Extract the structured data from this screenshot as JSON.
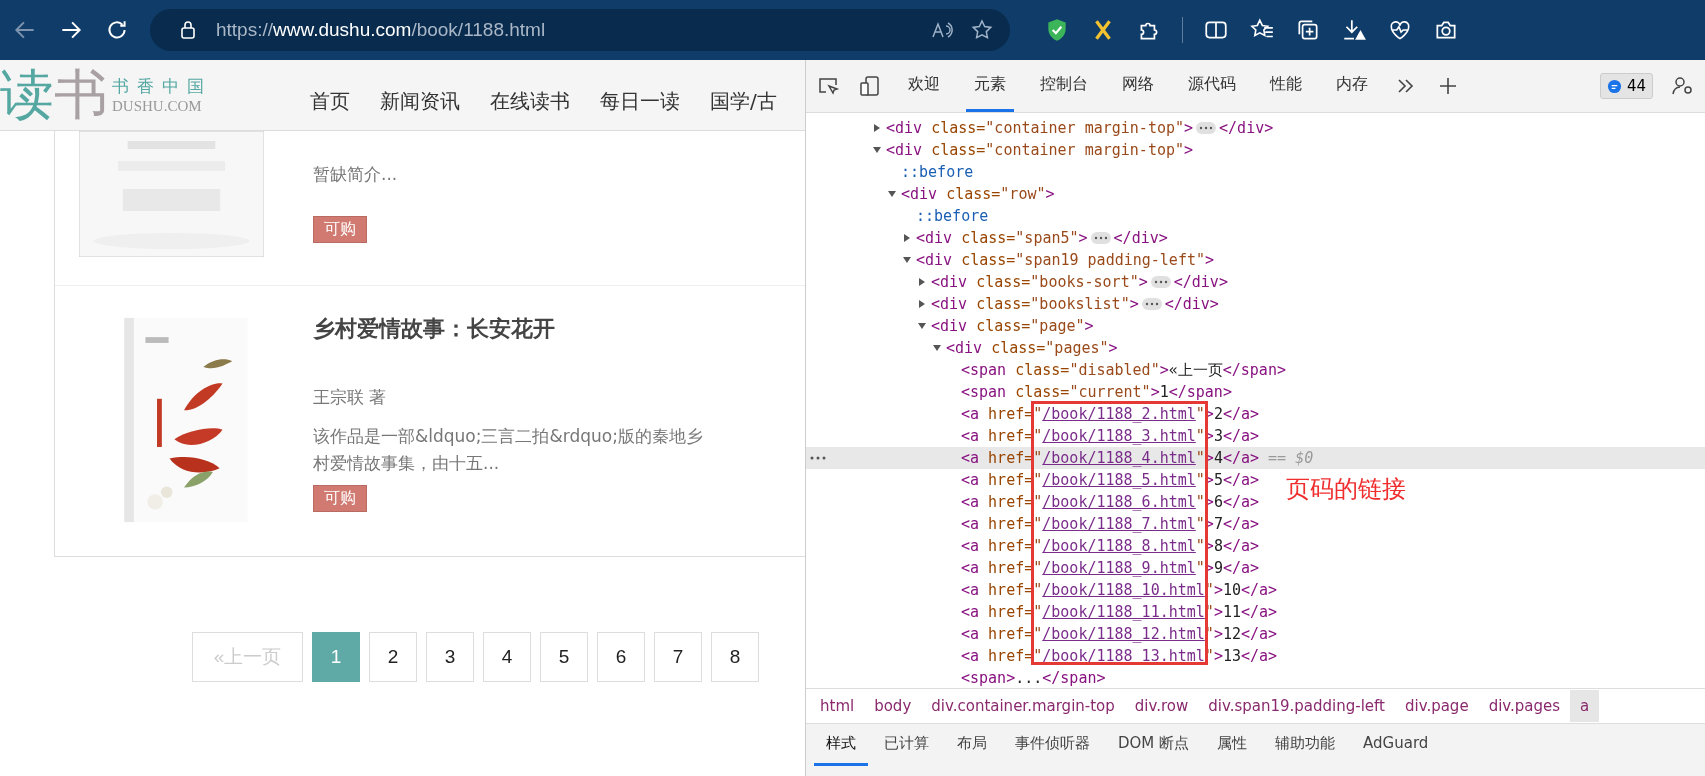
{
  "browser": {
    "url": {
      "scheme": "https://",
      "host": "www.dushu.com",
      "path": "/book/1188.html"
    }
  },
  "site": {
    "logo": {
      "mark_first": "读",
      "mark_second": "书",
      "tagline": "书香中国",
      "domain": "DUSHU.COM"
    },
    "nav": [
      "首页",
      "新闻资讯",
      "在线读书",
      "每日一读",
      "国学/古"
    ],
    "books": [
      {
        "intro": "暂缺简介...",
        "badge": "可购"
      },
      {
        "title": "乡村爱情故事：长安花开",
        "author": "王宗联 著",
        "intro": "该作品是一部&ldquo;三言二拍&rdquo;版的秦地乡村爱情故事集，由十五...",
        "badge": "可购"
      }
    ],
    "pagination": [
      {
        "label": "«上一页",
        "disabled": true,
        "selected": false
      },
      {
        "label": "1",
        "disabled": false,
        "selected": true
      },
      {
        "label": "2",
        "disabled": false,
        "selected": false
      },
      {
        "label": "3",
        "disabled": false,
        "selected": false
      },
      {
        "label": "4",
        "disabled": false,
        "selected": false
      },
      {
        "label": "5",
        "disabled": false,
        "selected": false
      },
      {
        "label": "6",
        "disabled": false,
        "selected": false
      },
      {
        "label": "7",
        "disabled": false,
        "selected": false
      },
      {
        "label": "8",
        "disabled": false,
        "selected": false
      }
    ]
  },
  "devtools": {
    "tabs": [
      {
        "label": "欢迎",
        "selected": false
      },
      {
        "label": "元素",
        "selected": true
      },
      {
        "label": "控制台",
        "selected": false
      },
      {
        "label": "网络",
        "selected": false
      },
      {
        "label": "源代码",
        "selected": false
      },
      {
        "label": "性能",
        "selected": false
      },
      {
        "label": "内存",
        "selected": false
      }
    ],
    "issues_count": "44",
    "dom": [
      {
        "selected": false,
        "expanded": false,
        "close_tag": "</div>",
        "parts": [
          {
            "kind": "tag",
            "text": "<div"
          },
          {
            "kind": "attr",
            "text": " class="
          },
          {
            "kind": "value",
            "text": "\"container margin-top\""
          },
          {
            "kind": "tag",
            "text": ">"
          }
        ]
      },
      {
        "selected": false,
        "expanded": true,
        "parts": [
          {
            "kind": "tag",
            "text": "<div"
          },
          {
            "kind": "attr",
            "text": " class="
          },
          {
            "kind": "value",
            "text": "\"container margin-top\""
          },
          {
            "kind": "tag",
            "text": ">"
          }
        ],
        "children": [
          {
            "selected": false,
            "parts": [
              {
                "kind": "pseudo",
                "text": "::before"
              }
            ]
          },
          {
            "selected": false,
            "expanded": true,
            "parts": [
              {
                "kind": "tag",
                "text": "<div"
              },
              {
                "kind": "attr",
                "text": " class="
              },
              {
                "kind": "value",
                "text": "\"row\""
              },
              {
                "kind": "tag",
                "text": ">"
              }
            ],
            "children": [
              {
                "selected": false,
                "parts": [
                  {
                    "kind": "pseudo",
                    "text": "::before"
                  }
                ]
              },
              {
                "selected": false,
                "expanded": false,
                "close_tag": "</div>",
                "parts": [
                  {
                    "kind": "tag",
                    "text": "<div"
                  },
                  {
                    "kind": "attr",
                    "text": " class="
                  },
                  {
                    "kind": "value",
                    "text": "\"span5\""
                  },
                  {
                    "kind": "tag",
                    "text": ">"
                  }
                ]
              },
              {
                "selected": false,
                "expanded": true,
                "parts": [
                  {
                    "kind": "tag",
                    "text": "<div"
                  },
                  {
                    "kind": "attr",
                    "text": " class="
                  },
                  {
                    "kind": "value",
                    "text": "\"span19 padding-left\""
                  },
                  {
                    "kind": "tag",
                    "text": ">"
                  }
                ],
                "children": [
                  {
                    "selected": false,
                    "expanded": false,
                    "close_tag": "</div>",
                    "parts": [
                      {
                        "kind": "tag",
                        "text": "<div"
                      },
                      {
                        "kind": "attr",
                        "text": " class="
                      },
                      {
                        "kind": "value",
                        "text": "\"books-sort\""
                      },
                      {
                        "kind": "tag",
                        "text": ">"
                      }
                    ]
                  },
                  {
                    "selected": false,
                    "expanded": false,
                    "close_tag": "</div>",
                    "parts": [
                      {
                        "kind": "tag",
                        "text": "<div"
                      },
                      {
                        "kind": "attr",
                        "text": " class="
                      },
                      {
                        "kind": "value",
                        "text": "\"bookslist\""
                      },
                      {
                        "kind": "tag",
                        "text": ">"
                      }
                    ]
                  },
                  {
                    "selected": false,
                    "expanded": true,
                    "parts": [
                      {
                        "kind": "tag",
                        "text": "<div"
                      },
                      {
                        "kind": "attr",
                        "text": " class="
                      },
                      {
                        "kind": "value",
                        "text": "\"page\""
                      },
                      {
                        "kind": "tag",
                        "text": ">"
                      }
                    ],
                    "children": [
                      {
                        "selected": false,
                        "expanded": true,
                        "parts": [
                          {
                            "kind": "tag",
                            "text": "<div"
                          },
                          {
                            "kind": "attr",
                            "text": " class="
                          },
                          {
                            "kind": "value",
                            "text": "\"pages\""
                          },
                          {
                            "kind": "tag",
                            "text": ">"
                          }
                        ],
                        "children": [
                          {
                            "selected": false,
                            "parts": [
                              {
                                "kind": "tag",
                                "text": "<span"
                              },
                              {
                                "kind": "attr",
                                "text": " class="
                              },
                              {
                                "kind": "value",
                                "text": "\"disabled\""
                              },
                              {
                                "kind": "tag",
                                "text": ">"
                              },
                              {
                                "kind": "text",
                                "text": "«上一页"
                              },
                              {
                                "kind": "tag",
                                "text": "</span>"
                              }
                            ]
                          },
                          {
                            "selected": false,
                            "parts": [
                              {
                                "kind": "tag",
                                "text": "<span"
                              },
                              {
                                "kind": "attr",
                                "text": " class="
                              },
                              {
                                "kind": "value",
                                "text": "\"current\""
                              },
                              {
                                "kind": "tag",
                                "text": ">"
                              },
                              {
                                "kind": "text",
                                "text": "1"
                              },
                              {
                                "kind": "tag",
                                "text": "</span>"
                              }
                            ]
                          },
                          {
                            "selected": false,
                            "parts": [
                              {
                                "kind": "tag",
                                "text": "<a"
                              },
                              {
                                "kind": "attr",
                                "text": " href="
                              },
                              {
                                "kind": "value",
                                "text": "\""
                              },
                              {
                                "kind": "link",
                                "text": "/book/1188_2.html"
                              },
                              {
                                "kind": "value",
                                "text": "\""
                              },
                              {
                                "kind": "tag",
                                "text": ">"
                              },
                              {
                                "kind": "text",
                                "text": "2"
                              },
                              {
                                "kind": "tag",
                                "text": "</a>"
                              }
                            ]
                          },
                          {
                            "selected": false,
                            "parts": [
                              {
                                "kind": "tag",
                                "text": "<a"
                              },
                              {
                                "kind": "attr",
                                "text": " href="
                              },
                              {
                                "kind": "value",
                                "text": "\""
                              },
                              {
                                "kind": "link",
                                "text": "/book/1188_3.html"
                              },
                              {
                                "kind": "value",
                                "text": "\""
                              },
                              {
                                "kind": "tag",
                                "text": ">"
                              },
                              {
                                "kind": "text",
                                "text": "3"
                              },
                              {
                                "kind": "tag",
                                "text": "</a>"
                              }
                            ]
                          },
                          {
                            "selected": true,
                            "parts": [
                              {
                                "kind": "tag",
                                "text": "<a"
                              },
                              {
                                "kind": "attr",
                                "text": " href="
                              },
                              {
                                "kind": "value",
                                "text": "\""
                              },
                              {
                                "kind": "link",
                                "text": "/book/1188_4.html"
                              },
                              {
                                "kind": "value",
                                "text": "\""
                              },
                              {
                                "kind": "tag",
                                "text": ">"
                              },
                              {
                                "kind": "text",
                                "text": "4"
                              },
                              {
                                "kind": "tag",
                                "text": "</a>"
                              },
                              {
                                "kind": "ref",
                                "text": " == $0"
                              }
                            ]
                          },
                          {
                            "selected": false,
                            "parts": [
                              {
                                "kind": "tag",
                                "text": "<a"
                              },
                              {
                                "kind": "attr",
                                "text": " href="
                              },
                              {
                                "kind": "value",
                                "text": "\""
                              },
                              {
                                "kind": "link",
                                "text": "/book/1188_5.html"
                              },
                              {
                                "kind": "value",
                                "text": "\""
                              },
                              {
                                "kind": "tag",
                                "text": ">"
                              },
                              {
                                "kind": "text",
                                "text": "5"
                              },
                              {
                                "kind": "tag",
                                "text": "</a>"
                              }
                            ]
                          },
                          {
                            "selected": false,
                            "parts": [
                              {
                                "kind": "tag",
                                "text": "<a"
                              },
                              {
                                "kind": "attr",
                                "text": " href="
                              },
                              {
                                "kind": "value",
                                "text": "\""
                              },
                              {
                                "kind": "link",
                                "text": "/book/1188_6.html"
                              },
                              {
                                "kind": "value",
                                "text": "\""
                              },
                              {
                                "kind": "tag",
                                "text": ">"
                              },
                              {
                                "kind": "text",
                                "text": "6"
                              },
                              {
                                "kind": "tag",
                                "text": "</a>"
                              }
                            ]
                          },
                          {
                            "selected": false,
                            "parts": [
                              {
                                "kind": "tag",
                                "text": "<a"
                              },
                              {
                                "kind": "attr",
                                "text": " href="
                              },
                              {
                                "kind": "value",
                                "text": "\""
                              },
                              {
                                "kind": "link",
                                "text": "/book/1188_7.html"
                              },
                              {
                                "kind": "value",
                                "text": "\""
                              },
                              {
                                "kind": "tag",
                                "text": ">"
                              },
                              {
                                "kind": "text",
                                "text": "7"
                              },
                              {
                                "kind": "tag",
                                "text": "</a>"
                              }
                            ]
                          },
                          {
                            "selected": false,
                            "parts": [
                              {
                                "kind": "tag",
                                "text": "<a"
                              },
                              {
                                "kind": "attr",
                                "text": " href="
                              },
                              {
                                "kind": "value",
                                "text": "\""
                              },
                              {
                                "kind": "link",
                                "text": "/book/1188_8.html"
                              },
                              {
                                "kind": "value",
                                "text": "\""
                              },
                              {
                                "kind": "tag",
                                "text": ">"
                              },
                              {
                                "kind": "text",
                                "text": "8"
                              },
                              {
                                "kind": "tag",
                                "text": "</a>"
                              }
                            ]
                          },
                          {
                            "selected": false,
                            "parts": [
                              {
                                "kind": "tag",
                                "text": "<a"
                              },
                              {
                                "kind": "attr",
                                "text": " href="
                              },
                              {
                                "kind": "value",
                                "text": "\""
                              },
                              {
                                "kind": "link",
                                "text": "/book/1188_9.html"
                              },
                              {
                                "kind": "value",
                                "text": "\""
                              },
                              {
                                "kind": "tag",
                                "text": ">"
                              },
                              {
                                "kind": "text",
                                "text": "9"
                              },
                              {
                                "kind": "tag",
                                "text": "</a>"
                              }
                            ]
                          },
                          {
                            "selected": false,
                            "parts": [
                              {
                                "kind": "tag",
                                "text": "<a"
                              },
                              {
                                "kind": "attr",
                                "text": " href="
                              },
                              {
                                "kind": "value",
                                "text": "\""
                              },
                              {
                                "kind": "link",
                                "text": "/book/1188_10.html"
                              },
                              {
                                "kind": "value",
                                "text": "\""
                              },
                              {
                                "kind": "tag",
                                "text": ">"
                              },
                              {
                                "kind": "text",
                                "text": "10"
                              },
                              {
                                "kind": "tag",
                                "text": "</a>"
                              }
                            ]
                          },
                          {
                            "selected": false,
                            "parts": [
                              {
                                "kind": "tag",
                                "text": "<a"
                              },
                              {
                                "kind": "attr",
                                "text": " href="
                              },
                              {
                                "kind": "value",
                                "text": "\""
                              },
                              {
                                "kind": "link",
                                "text": "/book/1188_11.html"
                              },
                              {
                                "kind": "value",
                                "text": "\""
                              },
                              {
                                "kind": "tag",
                                "text": ">"
                              },
                              {
                                "kind": "text",
                                "text": "11"
                              },
                              {
                                "kind": "tag",
                                "text": "</a>"
                              }
                            ]
                          },
                          {
                            "selected": false,
                            "parts": [
                              {
                                "kind": "tag",
                                "text": "<a"
                              },
                              {
                                "kind": "attr",
                                "text": " href="
                              },
                              {
                                "kind": "value",
                                "text": "\""
                              },
                              {
                                "kind": "link",
                                "text": "/book/1188_12.html"
                              },
                              {
                                "kind": "value",
                                "text": "\""
                              },
                              {
                                "kind": "tag",
                                "text": ">"
                              },
                              {
                                "kind": "text",
                                "text": "12"
                              },
                              {
                                "kind": "tag",
                                "text": "</a>"
                              }
                            ]
                          },
                          {
                            "selected": false,
                            "parts": [
                              {
                                "kind": "tag",
                                "text": "<a"
                              },
                              {
                                "kind": "attr",
                                "text": " href="
                              },
                              {
                                "kind": "value",
                                "text": "\""
                              },
                              {
                                "kind": "link",
                                "text": "/book/1188_13.html"
                              },
                              {
                                "kind": "value",
                                "text": "\""
                              },
                              {
                                "kind": "tag",
                                "text": ">"
                              },
                              {
                                "kind": "text",
                                "text": "13"
                              },
                              {
                                "kind": "tag",
                                "text": "</a>"
                              }
                            ]
                          },
                          {
                            "selected": false,
                            "parts": [
                              {
                                "kind": "tag",
                                "text": "<span>"
                              },
                              {
                                "kind": "text",
                                "text": "..."
                              },
                              {
                                "kind": "tag",
                                "text": "</span>"
                              }
                            ]
                          }
                        ]
                      }
                    ]
                  }
                ]
              }
            ]
          }
        ]
      }
    ],
    "annotation": "页码的链接",
    "breadcrumbs": [
      {
        "label": "html",
        "selected": false
      },
      {
        "label": "body",
        "selected": false
      },
      {
        "label": "div.container.margin-top",
        "selected": false
      },
      {
        "label": "div.row",
        "selected": false
      },
      {
        "label": "div.span19.padding-left",
        "selected": false
      },
      {
        "label": "div.page",
        "selected": false
      },
      {
        "label": "div.pages",
        "selected": false
      },
      {
        "label": "a",
        "selected": true
      }
    ],
    "panel_tabs": [
      {
        "label": "样式",
        "selected": true
      },
      {
        "label": "已计算",
        "selected": false
      },
      {
        "label": "布局",
        "selected": false
      },
      {
        "label": "事件侦听器",
        "selected": false
      },
      {
        "label": "DOM 断点",
        "selected": false
      },
      {
        "label": "属性",
        "selected": false
      },
      {
        "label": "辅助功能",
        "selected": false
      },
      {
        "label": "AdGuard",
        "selected": false
      }
    ]
  }
}
